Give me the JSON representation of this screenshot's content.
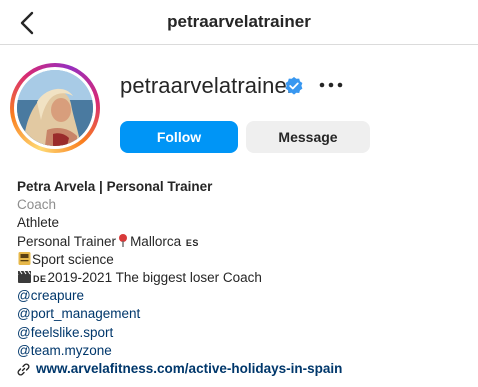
{
  "header": {
    "title": "petraarvelatrainer"
  },
  "profile": {
    "username": "petraarvelatrainer",
    "verified": true,
    "follow_label": "Follow",
    "message_label": "Message"
  },
  "bio": {
    "name": "Petra Arvela | Personal Trainer",
    "category": "Coach",
    "line_athlete": "Athlete",
    "line_trainer_a": "Personal Trainer",
    "line_trainer_b": "Mallorca",
    "flag_es": "ES",
    "line_sport": "Sport science",
    "flag_de": "DE",
    "line_coach": "2019-2021 The biggest loser Coach",
    "mentions": [
      "@creapure",
      "@port_management",
      "@feelslike.sport",
      "@team.myzone"
    ],
    "link": "www.arvelafitness.com/active-holidays-in-spain"
  },
  "colors": {
    "accent": "#0095f6",
    "verified": "#3897f0",
    "mention": "#00376b",
    "secondary_text": "#8e8e8e"
  },
  "icons": [
    "back-arrow-icon",
    "verified-badge-icon",
    "more-options-icon",
    "pushpin-icon",
    "notebook-icon",
    "clapperboard-icon",
    "link-icon"
  ]
}
